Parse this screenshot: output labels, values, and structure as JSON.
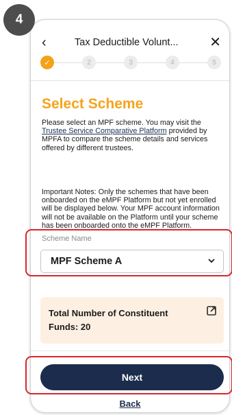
{
  "step_badge": "4",
  "header": {
    "title": "Tax Deductible Volunt...",
    "back_glyph": "‹",
    "close_glyph": "✕"
  },
  "stepper": {
    "steps": [
      "✓",
      "2",
      "3",
      "4",
      "5"
    ],
    "current": 1
  },
  "section_title": "Select Scheme",
  "intro": {
    "before_link": "Please select an MPF scheme. You may visit the ",
    "link_text": "Trustee Service Comparative Platform",
    "after_link": " provided by MPFA to compare the scheme details and services offered by different trustees."
  },
  "notes": "Important Notes: Only the schemes that have been onboarded on the eMPF Platform but not yet enrolled will be displayed below. Your MPF account information will not be available on the Platform until your scheme has been onboarded onto the eMPF Platform.",
  "scheme_field": {
    "label": "Scheme Name",
    "value": "MPF Scheme A"
  },
  "info_card": {
    "text": "Total Number of Constituent Funds: 20"
  },
  "buttons": {
    "next": "Next",
    "back": "Back"
  },
  "colors": {
    "accent": "#f5a31a",
    "primary": "#1c2c4c",
    "highlight": "#d7262e",
    "card_bg": "#fdf0e2"
  }
}
